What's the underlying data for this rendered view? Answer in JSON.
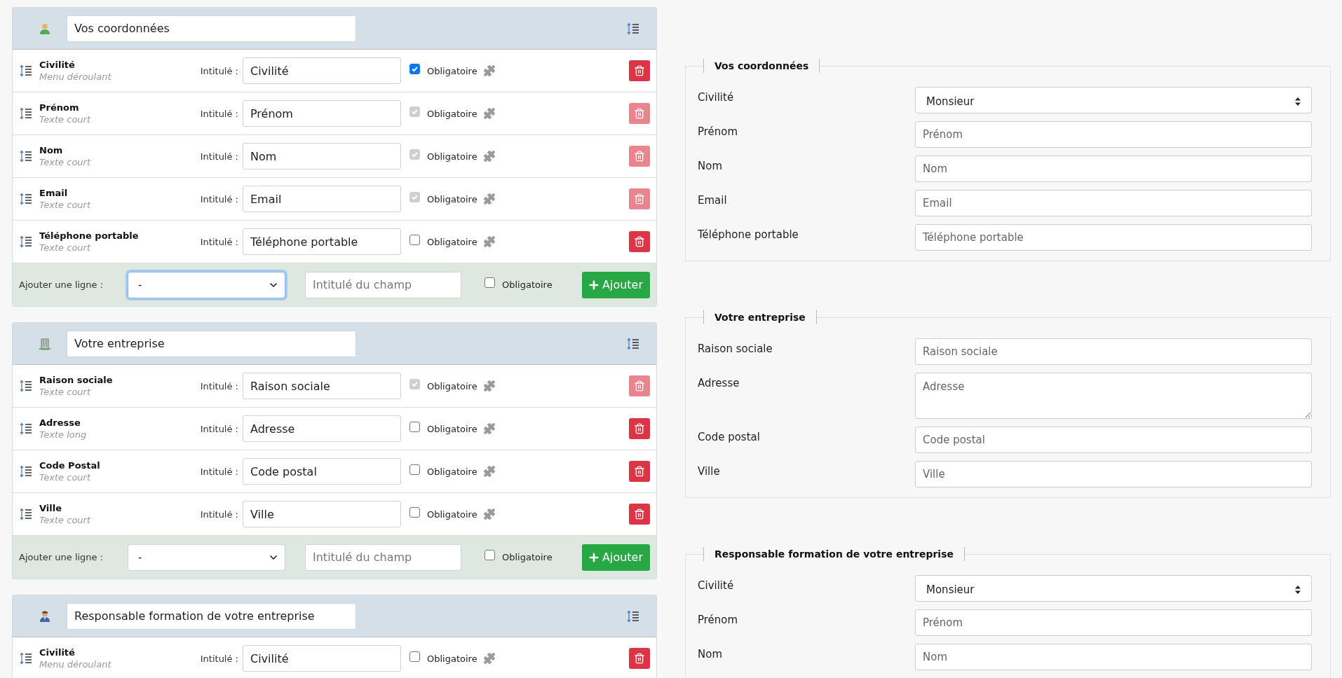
{
  "cards": [
    {
      "title": "Vos coordonnées",
      "kind": "person",
      "fields": [
        {
          "name": "Civilité",
          "type": "Menu déroulant",
          "caption": "Intitulé :",
          "label": "Civilité",
          "required": true,
          "locked": false,
          "required_label": "Obligatoire"
        },
        {
          "name": "Prénom",
          "type": "Texte court",
          "caption": "Intitulé :",
          "label": "Prénom",
          "required": true,
          "locked": true,
          "required_label": "Obligatoire"
        },
        {
          "name": "Nom",
          "type": "Texte court",
          "caption": "Intitulé :",
          "label": "Nom",
          "required": true,
          "locked": true,
          "required_label": "Obligatoire"
        },
        {
          "name": "Email",
          "type": "Texte court",
          "caption": "Intitulé :",
          "label": "Email",
          "required": true,
          "locked": true,
          "required_label": "Obligatoire"
        },
        {
          "name": "Téléphone portable",
          "type": "Texte court",
          "caption": "Intitulé :",
          "label": "Téléphone portable",
          "required": false,
          "locked": false,
          "required_label": "Obligatoire"
        }
      ],
      "add_row": {
        "label": "Ajouter une ligne :",
        "type_value": "-",
        "focused": true,
        "placeholder": "Intitulé du champ",
        "required": false,
        "required_label": "Obligatoire",
        "button": "Ajouter"
      }
    },
    {
      "title": "Votre entreprise",
      "kind": "building",
      "fields": [
        {
          "name": "Raison sociale",
          "type": "Texte court",
          "caption": "Intitulé :",
          "label": "Raison sociale",
          "required": true,
          "locked": true,
          "required_label": "Obligatoire"
        },
        {
          "name": "Adresse",
          "type": "Texte long",
          "caption": "Intitulé :",
          "label": "Adresse",
          "required": false,
          "locked": false,
          "required_label": "Obligatoire"
        },
        {
          "name": "Code Postal",
          "type": "Texte court",
          "caption": "Intitulé :",
          "label": "Code postal",
          "required": false,
          "locked": false,
          "required_label": "Obligatoire"
        },
        {
          "name": "Ville",
          "type": "Texte court",
          "caption": "Intitulé :",
          "label": "Ville",
          "required": false,
          "locked": false,
          "required_label": "Obligatoire"
        }
      ],
      "add_row": {
        "label": "Ajouter une ligne :",
        "type_value": "-",
        "focused": false,
        "placeholder": "Intitulé du champ",
        "required": false,
        "required_label": "Obligatoire",
        "button": "Ajouter"
      }
    },
    {
      "title": "Responsable formation de votre entreprise",
      "kind": "manager",
      "fields": [
        {
          "name": "Civilité",
          "type": "Menu déroulant",
          "caption": "Intitulé :",
          "label": "Civilité",
          "required": false,
          "locked": false,
          "required_label": "Obligatoire"
        }
      ]
    }
  ],
  "preview": [
    {
      "legend": "Vos coordonnées",
      "fields": [
        {
          "label": "Civilité",
          "kind": "select",
          "value": "Monsieur"
        },
        {
          "label": "Prénom",
          "kind": "input",
          "placeholder": "Prénom"
        },
        {
          "label": "Nom",
          "kind": "input",
          "placeholder": "Nom"
        },
        {
          "label": "Email",
          "kind": "input",
          "placeholder": "Email"
        },
        {
          "label": "Téléphone portable",
          "kind": "input",
          "placeholder": "Téléphone portable"
        }
      ]
    },
    {
      "legend": "Votre entreprise",
      "fields": [
        {
          "label": "Raison sociale",
          "kind": "input",
          "placeholder": "Raison sociale"
        },
        {
          "label": "Adresse",
          "kind": "textarea",
          "placeholder": "Adresse"
        },
        {
          "label": "Code postal",
          "kind": "input",
          "placeholder": "Code postal"
        },
        {
          "label": "Ville",
          "kind": "input",
          "placeholder": "Ville"
        }
      ]
    },
    {
      "legend": "Responsable formation de votre entreprise",
      "fields": [
        {
          "label": "Civilité",
          "kind": "select",
          "value": "Monsieur"
        },
        {
          "label": "Prénom",
          "kind": "input",
          "placeholder": "Prénom"
        },
        {
          "label": "Nom",
          "kind": "input",
          "placeholder": "Nom"
        }
      ]
    }
  ]
}
